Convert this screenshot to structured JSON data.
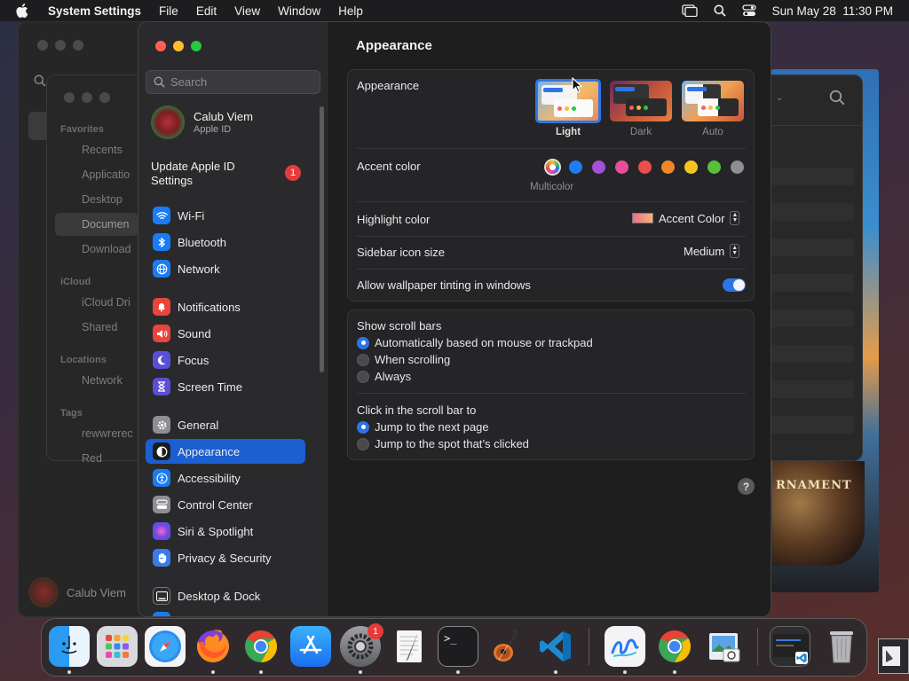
{
  "menubar": {
    "app": "System Settings",
    "items": [
      "File",
      "Edit",
      "View",
      "Window",
      "Help"
    ],
    "datetime": "Sun May 28  11:30 PM"
  },
  "finder": {
    "favorites_header": "Favorites",
    "favorites": [
      "Recents",
      "Applicatio",
      "Desktop",
      "Documen",
      "Download"
    ],
    "icloud_header": "iCloud",
    "icloud": [
      "iCloud Dri",
      "Shared"
    ],
    "locations_header": "Locations",
    "locations": [
      "Network"
    ],
    "tags_header": "Tags",
    "tags": [
      "rewwrerec",
      "Red"
    ],
    "user": "Calub Viem"
  },
  "background_art_text": "RNAMENT",
  "sidebar": {
    "search_placeholder": "Search",
    "profile_name": "Calub Viem",
    "profile_sub": "Apple ID",
    "update_label": "Update Apple ID Settings",
    "update_badge": "1",
    "items": [
      {
        "label": "Wi-Fi",
        "color": "#1a7cf5"
      },
      {
        "label": "Bluetooth",
        "color": "#1a7cf5"
      },
      {
        "label": "Network",
        "color": "#1a7cf5"
      },
      {
        "label": "Notifications",
        "color": "#e8453c"
      },
      {
        "label": "Sound",
        "color": "#e8453c"
      },
      {
        "label": "Focus",
        "color": "#5b4fd6"
      },
      {
        "label": "Screen Time",
        "color": "#5b4fd6"
      },
      {
        "label": "General",
        "color": "#8e8e93"
      },
      {
        "label": "Appearance",
        "color": "#1c1c1e"
      },
      {
        "label": "Accessibility",
        "color": "#1a7cf5"
      },
      {
        "label": "Control Center",
        "color": "#8e8e93"
      },
      {
        "label": "Siri & Spotlight",
        "color": "#b84fd0"
      },
      {
        "label": "Privacy & Security",
        "color": "#3a7be8"
      },
      {
        "label": "Desktop & Dock",
        "color": "#2c2c2e"
      }
    ],
    "active": "Appearance"
  },
  "content": {
    "title": "Appearance",
    "appearance_label": "Appearance",
    "modes": [
      "Light",
      "Dark",
      "Auto"
    ],
    "selected_mode": "Light",
    "accent_label": "Accent color",
    "accent_colors": [
      "#8e5cf0",
      "#1f7cf5",
      "#a550d6",
      "#ea4c9d",
      "#ec4d4d",
      "#f1872b",
      "#f6c51f",
      "#59bf3b",
      "#8e8e93"
    ],
    "accent_caption": "Multicolor",
    "highlight_label": "Highlight color",
    "highlight_value": "Accent Color",
    "sidebar_icon_label": "Sidebar icon size",
    "sidebar_icon_value": "Medium",
    "tinting_label": "Allow wallpaper tinting in windows",
    "tinting_on": true,
    "scrollbars_label": "Show scroll bars",
    "scrollbar_options": [
      "Automatically based on mouse or trackpad",
      "When scrolling",
      "Always"
    ],
    "scrollbar_selected": 0,
    "click_label": "Click in the scroll bar to",
    "click_options": [
      "Jump to the next page",
      "Jump to the spot that’s clicked"
    ],
    "click_selected": 0,
    "help": "?"
  },
  "dock": {
    "apps": [
      "Finder",
      "Launchpad",
      "Safari",
      "Firefox",
      "Chrome",
      "App Store",
      "System Settings",
      "TextEdit",
      "Terminal",
      "GarageBand",
      "VS Code",
      "Freeform",
      "Chrome",
      "Preview"
    ],
    "settings_badge": "1"
  }
}
